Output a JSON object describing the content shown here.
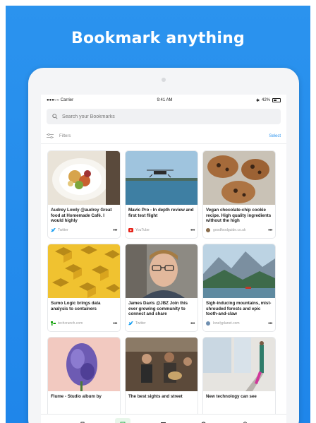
{
  "promo": {
    "headline": "Bookmark anything",
    "background_color": "#2b93ee"
  },
  "status_bar": {
    "carrier": "●●●○○ Carrier",
    "time": "9:41 AM",
    "battery": "42%"
  },
  "search": {
    "placeholder": "Search your Bookmarks"
  },
  "filters": {
    "label": "Filters",
    "select_label": "Select"
  },
  "cards": [
    {
      "title": "Audrey Lowly @audrey Great food at Homemade Café. I would highly",
      "source": "Twitter",
      "source_icon": "twitter-icon",
      "image": "salad-plate"
    },
    {
      "title": "Mavic Pro - In depth review and first test flight",
      "source": "YouTube",
      "source_icon": "youtube-icon",
      "image": "drone-over-lake"
    },
    {
      "title": "Vegan chocolate-chip cookie recipe. High quality ingredients without the high",
      "source": "goodfoodguide.co.uk",
      "source_icon": "site-icon",
      "image": "cookies"
    },
    {
      "title": "Sumo Logic brings data analysis to containers",
      "source": "techcrunch.com",
      "source_icon": "techcrunch-icon",
      "image": "yellow-cubes"
    },
    {
      "title": "James Davis @JBZ Join this ever growing community to connect and share",
      "source": "Twitter",
      "source_icon": "twitter-icon",
      "image": "man-with-glasses"
    },
    {
      "title": "Sigh-inducing mountains, mist-shrouded forests and epic tooth-and-claw",
      "source": "lonelyplanet.com",
      "source_icon": "site-icon",
      "image": "mountain-lake"
    },
    {
      "title": "Flume - Studio album by",
      "source": "",
      "source_icon": "",
      "image": "purple-flower"
    },
    {
      "title": "The best sights and street",
      "source": "",
      "source_icon": "",
      "image": "street-musicians"
    },
    {
      "title": "New technology can see",
      "source": "",
      "source_icon": "",
      "image": "person-shadow"
    }
  ],
  "tabbar": {
    "items": [
      {
        "name": "archive-icon",
        "active": false
      },
      {
        "name": "bookmark-icon",
        "active": true
      },
      {
        "name": "collections-icon",
        "active": false
      },
      {
        "name": "search-icon",
        "active": false
      },
      {
        "name": "profile-icon",
        "active": false
      }
    ],
    "active_color": "#2fae52"
  }
}
